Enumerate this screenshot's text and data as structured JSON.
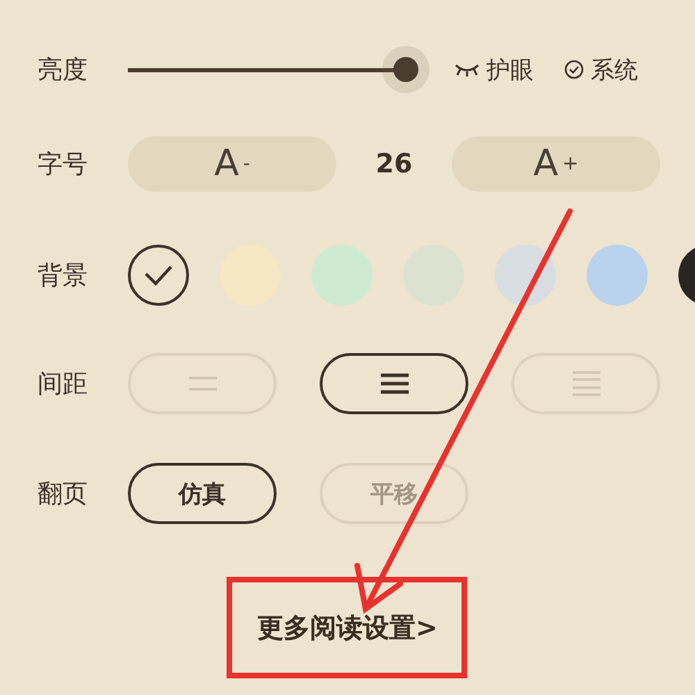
{
  "brightness": {
    "label": "亮度",
    "level": 1.0,
    "eye_care": "护眼",
    "system": "系统"
  },
  "font_size": {
    "label": "字号",
    "decrease": "A",
    "decrease_sign": "-",
    "value": "26",
    "increase": "A",
    "increase_sign": "+"
  },
  "background": {
    "label": "背景",
    "swatches": [
      {
        "color": "#ede3cf",
        "selected": true
      },
      {
        "color": "#f5e7c4",
        "selected": false
      },
      {
        "color": "#cdebd1",
        "selected": false
      },
      {
        "color": "#dde2d0",
        "selected": false
      },
      {
        "color": "#d8dde2",
        "selected": false
      },
      {
        "color": "#b9d2ed",
        "selected": false
      },
      {
        "color": "#2a2522",
        "selected": false
      }
    ]
  },
  "spacing": {
    "label": "间距",
    "options": [
      {
        "kind": "wide",
        "selected": false
      },
      {
        "kind": "normal",
        "selected": true
      },
      {
        "kind": "tight",
        "selected": false
      }
    ]
  },
  "page_turn": {
    "label": "翻页",
    "options": [
      {
        "label": "仿真",
        "selected": true
      },
      {
        "label": "平移",
        "selected": false
      }
    ]
  },
  "more_settings": "更多阅读设置>"
}
